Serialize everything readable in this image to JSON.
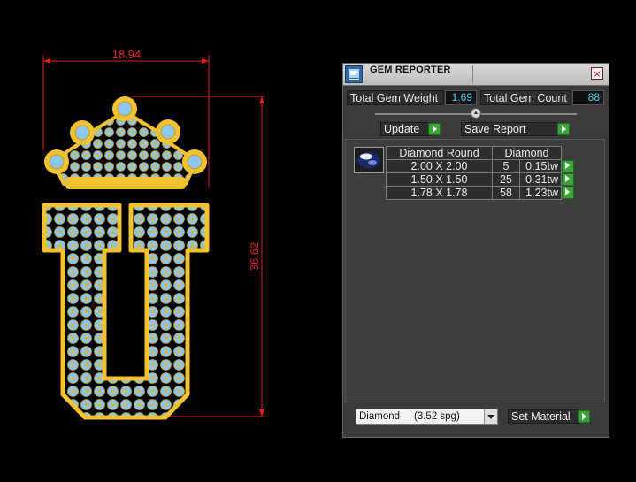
{
  "viewport": {
    "dimension_width": "18.94",
    "dimension_height": "36.62"
  },
  "panel": {
    "title": "GEM REPORTER",
    "close_label": "×",
    "total_gem_weight_label": "Total Gem Weight",
    "total_gem_weight_value": "1.69",
    "total_gem_count_label": "Total Gem Count",
    "total_gem_count_value": "88",
    "update_label": "Update",
    "save_report_label": "Save Report",
    "table": {
      "header_shape": "Diamond Round",
      "header_material": "Diamond",
      "rows": [
        {
          "size": "2.00 X 2.00",
          "count": "5",
          "weight": "0.15tw"
        },
        {
          "size": "1.50 X 1.50",
          "count": "25",
          "weight": "0.31tw"
        },
        {
          "size": "1.78 X 1.78",
          "count": "58",
          "weight": "1.23tw"
        }
      ]
    },
    "material_select_value": "Diamond     (3.52 spg)",
    "set_material_label": "Set Material"
  },
  "colors": {
    "dimension_line": "#e02020",
    "gold": "#f2c230",
    "gem": "#8cc6f0",
    "value_text": "#4fc8ff",
    "go_button": "#3aa33a"
  },
  "icons": [
    "gem-reporter-app-icon",
    "close-icon",
    "play-arrow-icon",
    "slider-knob-icon",
    "dropdown-arrow-icon",
    "diamond-gem-thumbnail"
  ]
}
